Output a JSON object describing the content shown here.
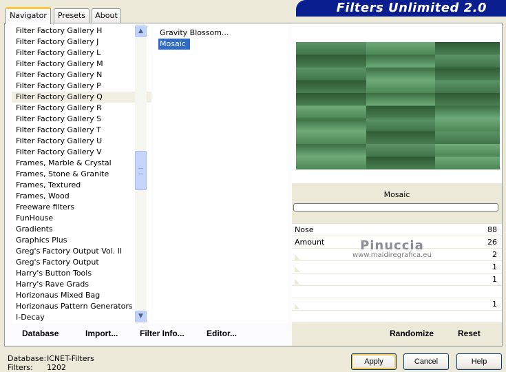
{
  "tabs": [
    {
      "label": "Navigator",
      "active": true
    },
    {
      "label": "Presets",
      "active": false
    },
    {
      "label": "About",
      "active": false
    }
  ],
  "app_title": "Filters Unlimited 2.0",
  "categories": [
    "Filter Factory Gallery H",
    "Filter Factory Gallery J",
    "Filter Factory Gallery L",
    "Filter Factory Gallery M",
    "Filter Factory Gallery N",
    "Filter Factory Gallery P",
    "Filter Factory Gallery Q",
    "Filter Factory Gallery R",
    "Filter Factory Gallery S",
    "Filter Factory Gallery T",
    "Filter Factory Gallery U",
    "Filter Factory Gallery V",
    "Frames, Marble & Crystal",
    "Frames, Stone & Granite",
    "Frames, Textured",
    "Frames, Wood",
    "Freeware filters",
    "FunHouse",
    "Gradients",
    "Graphics Plus",
    "Greg's Factory Output Vol. II",
    "Greg's Factory Output",
    "Harry's Button Tools",
    "Harry's Rave Grads",
    "Horizonaus Mixed Bag",
    "Horizonaus Pattern Generators",
    "I-Decay"
  ],
  "selected_category": "Filter Factory Gallery Q",
  "filters": [
    "Gravity Blossom...",
    "Mosaic"
  ],
  "selected_filter": "Mosaic",
  "preview_title": "Mosaic",
  "params": [
    {
      "label": "Nose",
      "value": "88"
    },
    {
      "label": "Amount",
      "value": "26"
    },
    {
      "label": "",
      "value": "2"
    },
    {
      "label": "",
      "value": "1"
    },
    {
      "label": "",
      "value": "1"
    },
    {
      "label": "",
      "value": ""
    },
    {
      "label": "",
      "value": "1"
    },
    {
      "label": "",
      "value": ""
    }
  ],
  "watermark": {
    "name": "Pinuccia",
    "url": "www.maidiregrafica.eu"
  },
  "left_buttons": {
    "database": "Database",
    "import": "Import...",
    "filter_info": "Filter Info...",
    "editor": "Editor..."
  },
  "right_buttons": {
    "randomize": "Randomize",
    "reset": "Reset"
  },
  "footer": {
    "database_label": "Database:",
    "database_value": "ICNET-Filters",
    "filters_label": "Filters:",
    "filters_value": "1202"
  },
  "dialog_buttons": {
    "apply": "Apply",
    "cancel": "Cancel",
    "help": "Help"
  },
  "colors": {
    "selection": "#316AC5",
    "banner": "#0A1E8F",
    "preview_greens": [
      "#2F5F2F",
      "#6FAF7A",
      "#4E8A55",
      "#3E7344"
    ]
  }
}
